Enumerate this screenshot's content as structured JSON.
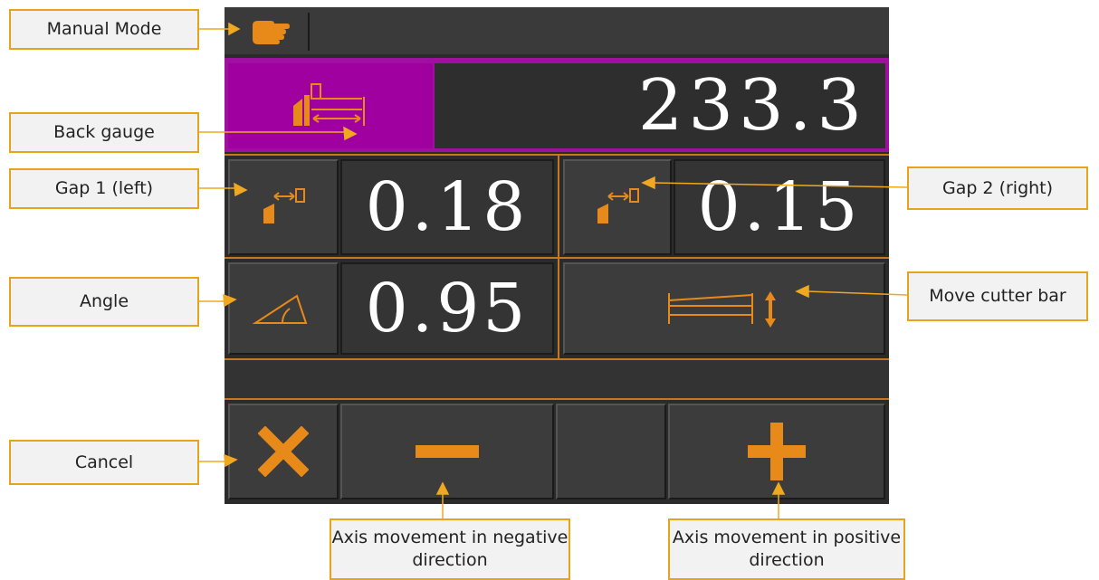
{
  "callouts": {
    "manual_mode": "Manual Mode",
    "back_gauge": "Back gauge",
    "gap1": "Gap 1 (left)",
    "angle": "Angle",
    "cancel": "Cancel",
    "gap2": "Gap 2 (right)",
    "move_cutter_bar": "Move cutter bar",
    "axis_negative": "Axis movement in negative direction",
    "axis_positive": "Axis movement in positive direction"
  },
  "values": {
    "back_gauge": "233.3",
    "gap1": "0.18",
    "gap2": "0.15",
    "angle": "0.95"
  },
  "icons": {
    "mode": "hand-icon",
    "back_gauge": "back-gauge-icon",
    "gap1": "gap-left-icon",
    "gap2": "gap-right-icon",
    "angle": "angle-icon",
    "cutter_bar": "cutter-bar-icon",
    "cancel": "cancel-x-icon",
    "minus": "minus-icon",
    "plus": "plus-icon"
  },
  "colors": {
    "accent": "#e88a1a",
    "highlight": "#a000a0",
    "callout_border": "#e8a31c"
  }
}
